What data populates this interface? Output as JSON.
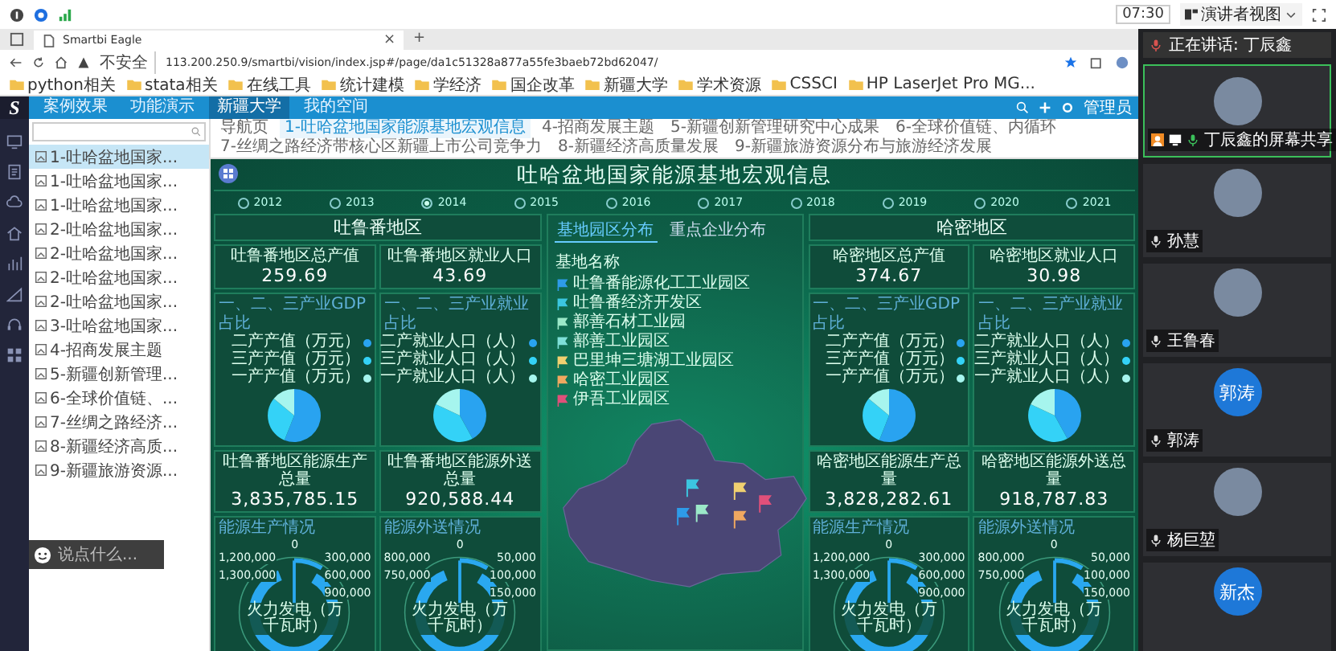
{
  "top_bar": {
    "timer": "07:30",
    "view_button": "演讲者视图"
  },
  "browser": {
    "tab_title": "Smartbi Eagle",
    "tab_close": "×",
    "new_tab": "+",
    "security_label": "不安全",
    "url": "113.200.250.9/smartbi/vision/index.jsp#/page/da1c51328a877a55fe3baeb72bd62047/",
    "bookmarks": [
      "python相关",
      "stata相关",
      "在线工具",
      "统计建模",
      "学经济",
      "国企改革",
      "新疆大学",
      "学术资源",
      "CSSCI",
      "HP LaserJet Pro MG..."
    ]
  },
  "app": {
    "logo_text": "S",
    "user": "管理员",
    "nav_tabs": [
      {
        "label": "案例效果",
        "selected": false
      },
      {
        "label": "功能演示",
        "selected": false
      },
      {
        "label": "新疆大学",
        "selected": true
      },
      {
        "label": "我的空间",
        "selected": false
      }
    ],
    "sidebar_items": [
      {
        "label": "1-吐哈盆地国家...",
        "selected": true
      },
      {
        "label": "1-吐哈盆地国家...",
        "selected": false
      },
      {
        "label": "1-吐哈盆地国家...",
        "selected": false
      },
      {
        "label": "2-吐哈盆地国家...",
        "selected": false
      },
      {
        "label": "2-吐哈盆地国家...",
        "selected": false
      },
      {
        "label": "2-吐哈盆地国家...",
        "selected": false
      },
      {
        "label": "2-吐哈盆地国家...",
        "selected": false
      },
      {
        "label": "3-吐哈盆地国家...",
        "selected": false
      },
      {
        "label": "4-招商发展主题",
        "selected": false
      },
      {
        "label": "5-新疆创新管理...",
        "selected": false
      },
      {
        "label": "6-全球价值链、...",
        "selected": false
      },
      {
        "label": "7-丝绸之路经济...",
        "selected": false
      },
      {
        "label": "8-新疆经济高质...",
        "selected": false
      },
      {
        "label": "9-新疆旅游资源...",
        "selected": false
      }
    ],
    "page_tabs": [
      {
        "label": "导航页",
        "selected": false
      },
      {
        "label": "1-吐哈盆地国家能源基地宏观信息",
        "selected": true
      },
      {
        "label": "4-招商发展主题",
        "selected": false
      },
      {
        "label": "5-新疆创新管理研究中心成果",
        "selected": false
      },
      {
        "label": "6-全球价值链、内循环",
        "selected": false
      },
      {
        "label": "7-丝绸之路经济带核心区新疆上市公司竞争力",
        "selected": false
      },
      {
        "label": "8-新疆经济高质量发展",
        "selected": false
      },
      {
        "label": "9-新疆旅游资源分布与旅游经济发展",
        "selected": false
      }
    ],
    "chat_placeholder": "说点什么..."
  },
  "dashboard": {
    "title": "吐哈盆地国家能源基地宏观信息",
    "years": [
      {
        "label": "2012",
        "selected": false
      },
      {
        "label": "2013",
        "selected": false
      },
      {
        "label": "2014",
        "selected": true
      },
      {
        "label": "2015",
        "selected": false
      },
      {
        "label": "2016",
        "selected": false
      },
      {
        "label": "2017",
        "selected": false
      },
      {
        "label": "2018",
        "selected": false
      },
      {
        "label": "2019",
        "selected": false
      },
      {
        "label": "2020",
        "selected": false
      },
      {
        "label": "2021",
        "selected": false
      }
    ],
    "regions": [
      {
        "name": "吐鲁番地区",
        "stats": [
          {
            "label": "吐鲁番地区总产值",
            "value": "259.69"
          },
          {
            "label": "吐鲁番地区就业人口",
            "value": "43.69"
          }
        ],
        "pies": [
          {
            "title": "一、二、三产业GDP占比",
            "legend": [
              "二产产值（万元）",
              "三产产值（万元）",
              "一产产值（万元）"
            ]
          },
          {
            "title": "一、二、三产业就业占比",
            "legend": [
              "二产就业人口（人）",
              "三产就业人口（人）",
              "一产就业人口（人）"
            ]
          }
        ],
        "totals": [
          {
            "label": "吐鲁番地区能源生产总量",
            "value": "3,835,785.15"
          },
          {
            "label": "吐鲁番地区能源外送总量",
            "value": "920,588.44"
          }
        ],
        "gauges": [
          {
            "title": "能源生产情况",
            "center_label": "火力发电（万千瓦时）",
            "ticks": [
              "0",
              "300,000",
              "600,000",
              "900,000",
              "1,200,000",
              "1,300,000"
            ]
          },
          {
            "title": "能源外送情况",
            "center_label": "火力发电（万千瓦时）",
            "ticks": [
              "0",
              "50,000",
              "100,000",
              "150,000",
              "800,000",
              "750,000"
            ]
          }
        ]
      },
      {
        "name": "哈密地区",
        "stats": [
          {
            "label": "哈密地区总产值",
            "value": "374.67"
          },
          {
            "label": "哈密地区就业人口",
            "value": "30.98"
          }
        ],
        "pies": [
          {
            "title": "一、二、三产业GDP占比",
            "legend": [
              "二产产值（万元）",
              "三产产值（万元）",
              "一产产值（万元）"
            ]
          },
          {
            "title": "一、二、三产业就业占比",
            "legend": [
              "二产就业人口（人）",
              "三产就业人口（人）",
              "一产就业人口（人）"
            ]
          }
        ],
        "totals": [
          {
            "label": "哈密地区能源生产总量",
            "value": "3,828,282.61"
          },
          {
            "label": "哈密地区能源外送总量",
            "value": "918,787.83"
          }
        ],
        "gauges": [
          {
            "title": "能源生产情况",
            "center_label": "火力发电（万千瓦时）",
            "ticks": [
              "0",
              "300,000",
              "600,000",
              "900,000",
              "1,200,000",
              "1,300,000"
            ]
          },
          {
            "title": "能源外送情况",
            "center_label": "火力发电（万千瓦时）",
            "ticks": [
              "0",
              "50,000",
              "100,000",
              "150,000",
              "800,000",
              "750,000"
            ]
          }
        ]
      }
    ],
    "center": {
      "tabs": [
        {
          "label": "基地园区分布",
          "selected": true
        },
        {
          "label": "重点企业分布",
          "selected": false
        }
      ],
      "legend_title": "基地名称",
      "legend": [
        {
          "label": "吐鲁番能源化工工业园区",
          "color": "#2e9be8"
        },
        {
          "label": "吐鲁番经济开发区",
          "color": "#3cc6e0"
        },
        {
          "label": "鄯善石材工业园",
          "color": "#9be8c8"
        },
        {
          "label": "鄯善工业园区",
          "color": "#7fe0d8"
        },
        {
          "label": "巴里坤三塘湖工业园区",
          "color": "#f0d070"
        },
        {
          "label": "哈密工业园区",
          "color": "#f0a860"
        },
        {
          "label": "伊吾工业园区",
          "color": "#e0507a"
        }
      ]
    }
  },
  "meeting": {
    "speaker": "正在讲话: 丁辰鑫",
    "participants": [
      {
        "kind": "share",
        "name": "丁辰鑫的屏幕共享"
      },
      {
        "kind": "photo",
        "name": "孙慧"
      },
      {
        "kind": "photo",
        "name": "王鲁春"
      },
      {
        "kind": "initials",
        "name": "郭涛",
        "avatar_text": "郭涛"
      },
      {
        "kind": "photo",
        "name": "杨巨堃"
      },
      {
        "kind": "initials",
        "avatar_text": "新杰"
      }
    ]
  }
}
